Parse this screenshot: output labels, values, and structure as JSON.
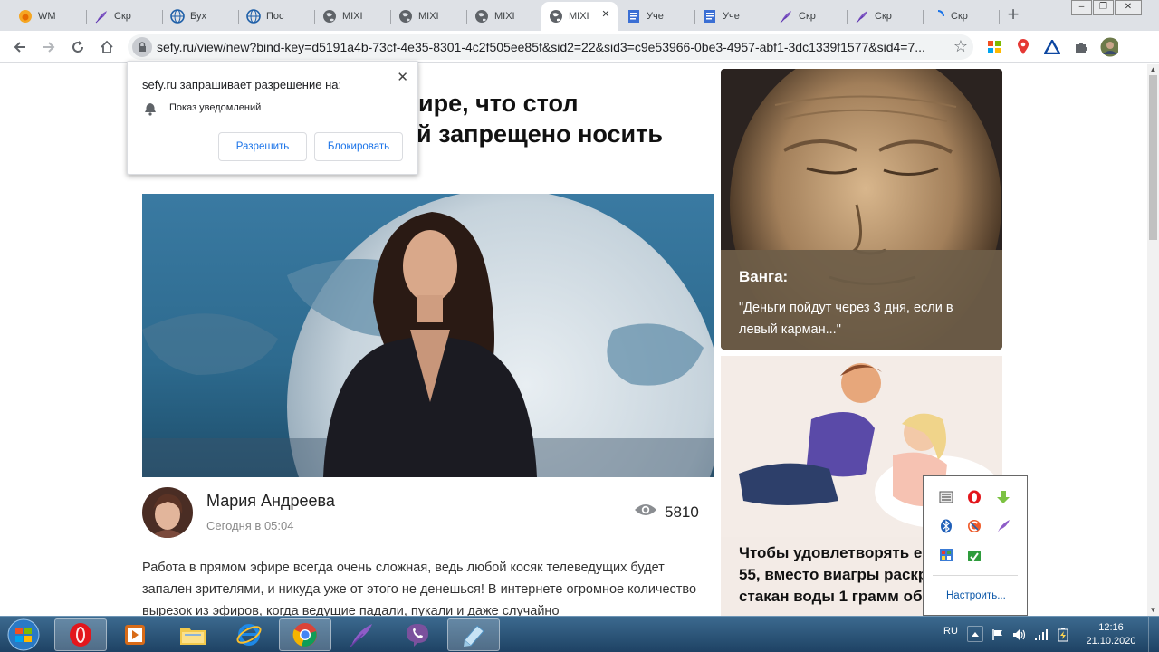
{
  "tabs": [
    {
      "label": "WM",
      "icon": "fire-icon"
    },
    {
      "label": "Скр",
      "icon": "feather-icon"
    },
    {
      "label": "Бух",
      "icon": "globe-blue-icon"
    },
    {
      "label": "Пос",
      "icon": "globe-blue-icon"
    },
    {
      "label": "MIXI",
      "icon": "globe-icon"
    },
    {
      "label": "MIXI",
      "icon": "globe-icon"
    },
    {
      "label": "MIXI",
      "icon": "globe-icon"
    },
    {
      "label": "MIXI",
      "icon": "globe-icon",
      "active": true
    },
    {
      "label": "Уче",
      "icon": "doc-icon"
    },
    {
      "label": "Уче",
      "icon": "doc-icon"
    },
    {
      "label": "Скр",
      "icon": "feather-icon"
    },
    {
      "label": "Скр",
      "icon": "feather-icon"
    },
    {
      "label": "Скр",
      "icon": "loading-icon"
    }
  ],
  "toolbar": {
    "url": "sefy.ru/view/new?bind-key=d5191a4b-73cf-4e35-8301-4c2f505ee85f&sid2=22&sid3=c9e53966-0be3-4957-abf1-3dc1339f1577&sid4=7..."
  },
  "permission": {
    "title": "sefy.ru запрашивает разрешение на:",
    "item": "Показ уведомлений",
    "allow": "Разрешить",
    "block": "Блокировать"
  },
  "article": {
    "headline_line1": "ире, что стол",
    "headline_line2": "й запрещено носить",
    "author": "Мария Андреева",
    "time": "Сегодня в 05:04",
    "views": "5810",
    "body": "Работа в прямом эфире всегда очень сложная, ведь любой косяк телеведущих будет запален зрителями, и никуда уже от этого не денешься! В интернете огромное количество вырезок из эфиров, когда ведущие падали, пукали и даже случайно"
  },
  "sidebar": {
    "card1": {
      "title": "Ванга:",
      "text": "\"Деньги пойдут через 3 дня, если в левый карман...\""
    },
    "card2": {
      "title": "Чтобы удовлетворять ее после 55, вместо виагры раскрошите в стакан воды 1 грамм обычного"
    }
  },
  "tray": {
    "configure": "Настроить..."
  },
  "taskbar": {
    "lang": "RU",
    "time": "12:16",
    "date": "21.10.2020"
  },
  "colors": {
    "accent_blue": "#1a73e8",
    "taskbar": "#2a5379",
    "opera_red": "#e3161c"
  }
}
